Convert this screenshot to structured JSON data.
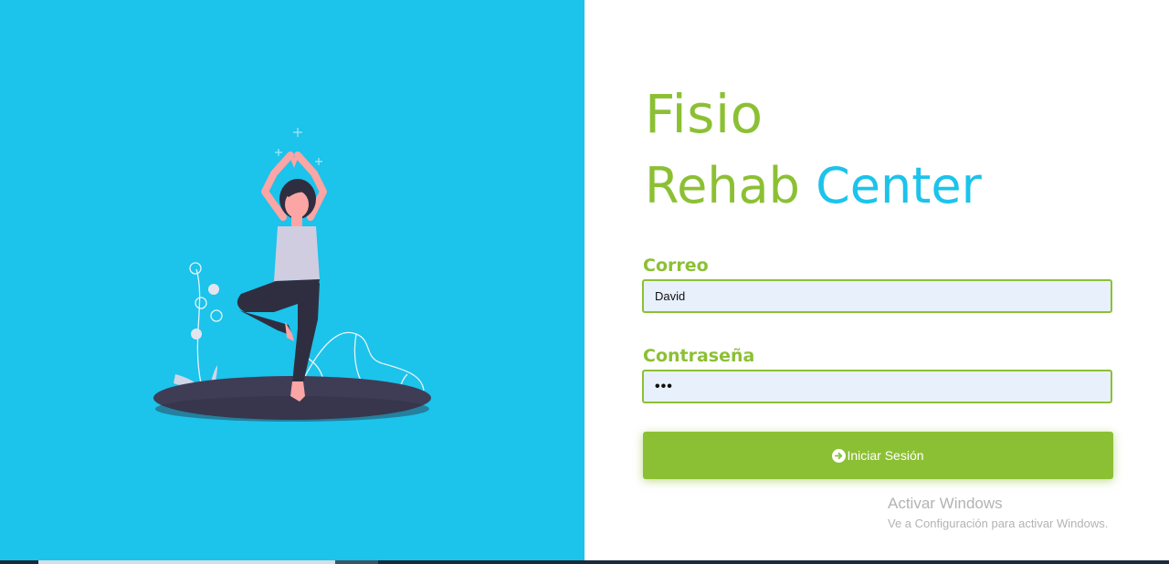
{
  "brand": {
    "line1": "Fisio",
    "line2_part1": "Rehab",
    "line2_part2": "Center"
  },
  "form": {
    "email_label": "Correo",
    "email_value": "David",
    "password_label": "Contraseña",
    "password_value": "•••",
    "submit_label": "Iniciar Sesión",
    "submit_icon": "arrow-circle-right-icon"
  },
  "watermark": {
    "title": "Activar Windows",
    "subtitle": "Ve a Configuración para activar Windows."
  },
  "colors": {
    "accent_green": "#8cc034",
    "accent_blue": "#1cc3eb",
    "input_bg": "#e8f0fc"
  }
}
